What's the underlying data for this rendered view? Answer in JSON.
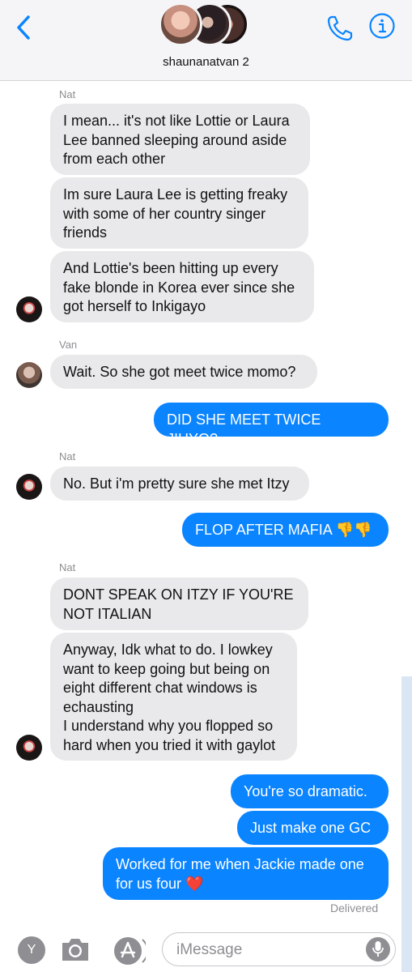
{
  "header": {
    "group_name": "shaunanatvan 2",
    "back_icon": "chevron-left-icon",
    "call_icon": "phone-icon",
    "info_icon": "info-icon",
    "accent": "#0a84ff"
  },
  "messages": {
    "nat_label_1": "Nat",
    "m1": "I mean... it's not like Lottie or Laura\nLee banned sleeping around aside\nfrom each other",
    "m2": "Im sure Laura Lee is getting freaky\nwith some of her country singer\nfriends",
    "m3": "And Lottie's been hitting up every\nfake blonde in Korea ever since she\ngot herself to Inkigayo",
    "van_label": "Van",
    "m4": "Wait. So she got meet twice momo?",
    "m5": "DID SHE MEET TWICE JIHYO?",
    "nat_label_2": "Nat",
    "m6": "No. But i'm pretty sure she met Itzy",
    "m7": "FLOP AFTER MAFIA 👎👎",
    "nat_label_3": "Nat",
    "m8": "DONT SPEAK ON ITZY IF YOU'RE\nNOT ITALIAN",
    "m9": "Anyway, Idk what to do. I lowkey\nwant to keep going but being on\neight different chat windows is\nechausting\nI understand why you flopped so\nhard when you tried it with gaylot",
    "m10": "You're so dramatic.",
    "m11": "Just make one GC",
    "m12": "Worked for me when Jackie made one\nfor us four ❤️",
    "delivered": "Delivered"
  },
  "bottom_bar": {
    "app_letter": "Y",
    "camera_icon": "camera-icon",
    "appstore_icon": "app-store-icon",
    "placeholder": "iMessage",
    "mic_icon": "microphone-icon"
  },
  "colors": {
    "outgoing_bubble": "#0a84ff",
    "incoming_bubble": "#e9e9eb"
  }
}
